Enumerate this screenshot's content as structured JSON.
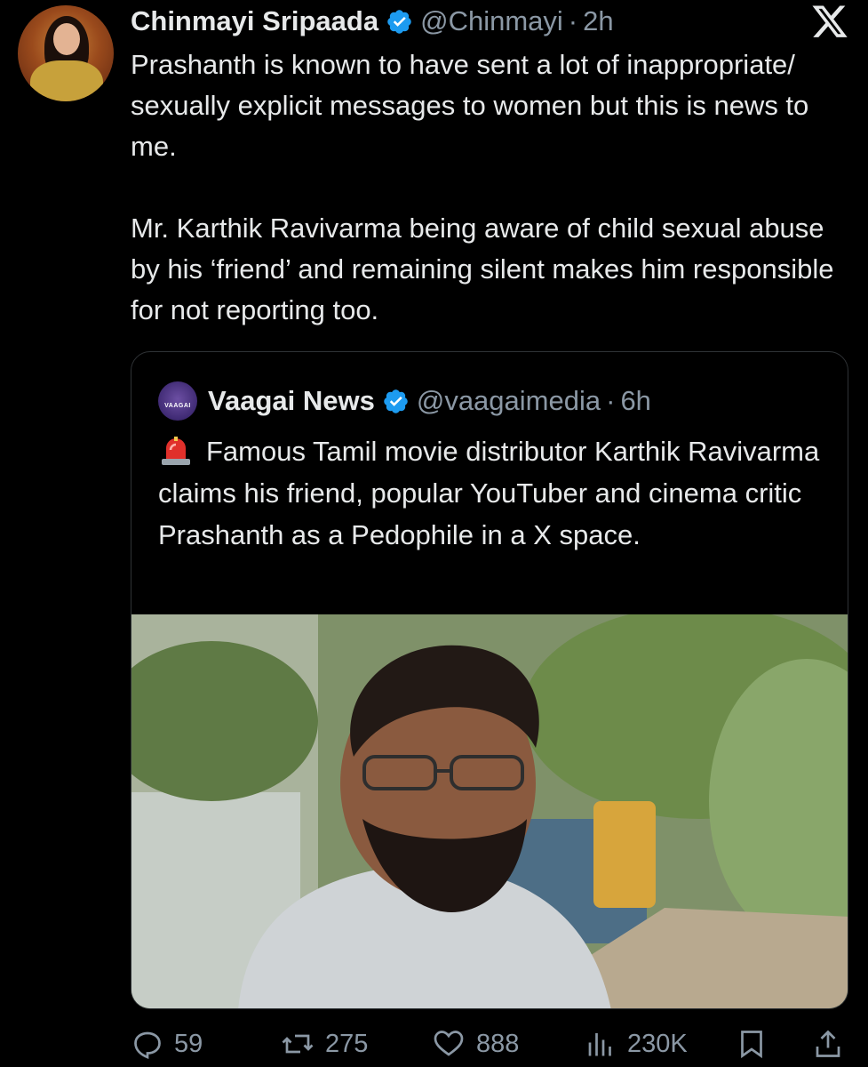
{
  "author": {
    "name": "Chinmayi Sripaada",
    "handle": "@Chinmayi",
    "separator": "·",
    "time": "2h"
  },
  "tweet": {
    "paragraphs": [
      "Prashanth is known to have sent a lot of inappropriate/ sexually explicit messages to women but this is news to me.",
      "Mr. Karthik Ravivarma being aware of child sexual abuse by his ‘friend’  and remaining silent makes him responsible for not reporting too."
    ]
  },
  "quoted": {
    "avatar_text": "VAAGAI",
    "name": "Vaagai News",
    "handle": "@vaagaimedia",
    "separator": "·",
    "time": "6h",
    "text": "Famous Tamil movie distributor Karthik Ravivarma claims his friend, popular YouTuber and cinema critic Prashanth as a Pedophile in a X space."
  },
  "actions": {
    "replies": "59",
    "reposts": "275",
    "likes": "888",
    "views": "230K"
  },
  "colors": {
    "background": "#000000",
    "text": "#e7e9ea",
    "muted": "#8b98a5",
    "verified": "#1d9bf0",
    "border": "#2f3336"
  },
  "icons": [
    "verified-badge-icon",
    "x-logo-icon",
    "siren-icon",
    "reply-icon",
    "repost-icon",
    "like-icon",
    "views-icon",
    "bookmark-icon",
    "share-icon"
  ]
}
